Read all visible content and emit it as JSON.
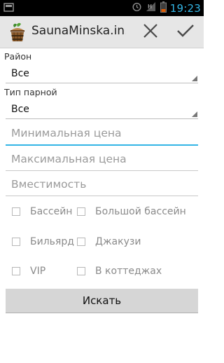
{
  "status_bar": {
    "time": "19:23",
    "icons": [
      "notification-icon",
      "alarm-icon",
      "no-signal-icon",
      "battery-icon"
    ],
    "accent": "#33b5e5"
  },
  "action_bar": {
    "title": "SaunaMinska.in…",
    "close_icon": "close-icon",
    "confirm_icon": "check-icon"
  },
  "form": {
    "district": {
      "label": "Район",
      "value": "Все"
    },
    "steam_room_type": {
      "label": "Тип парной",
      "value": "Все"
    },
    "min_price": {
      "placeholder": "Минимальная цена"
    },
    "max_price": {
      "placeholder": "Максимальная цена"
    },
    "capacity": {
      "placeholder": "Вместимость"
    },
    "checkboxes": [
      {
        "label": "Бассейн",
        "checked": false
      },
      {
        "label": "Большой бассейн",
        "checked": false
      },
      {
        "label": "Бильярд",
        "checked": false
      },
      {
        "label": "Джакузи",
        "checked": false
      },
      {
        "label": "VIP",
        "checked": false
      },
      {
        "label": "В коттеджах",
        "checked": false
      }
    ],
    "search_label": "Искать"
  }
}
